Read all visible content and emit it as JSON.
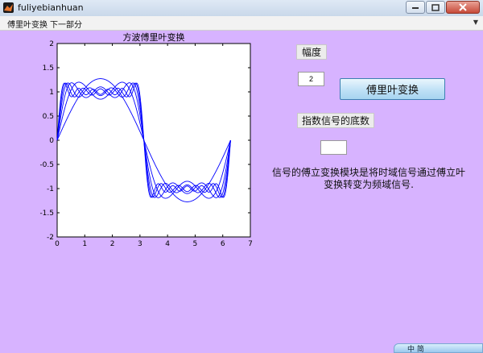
{
  "window": {
    "title": "fuliyebianhuan",
    "background": "#d7b3ff"
  },
  "menubar": {
    "items": [
      "傅里叶变换",
      "下一部分"
    ]
  },
  "chart_data": {
    "type": "line",
    "title": "方波傅里叶变换",
    "xlim": [
      0,
      7
    ],
    "ylim": [
      -2,
      2
    ],
    "xticks": [
      "0",
      "1",
      "2",
      "3",
      "4",
      "5",
      "6",
      "7"
    ],
    "yticks": [
      "2",
      "1.5",
      "1",
      "0.5",
      "0",
      "-0.5",
      "-1",
      "-1.5",
      "-2"
    ],
    "x_range": [
      0,
      6.2832
    ],
    "function": "(4/pi) * sum_{k=1..n} sin((2k-1)x)/(2k-1)",
    "series": [
      {
        "terms": 1
      },
      {
        "terms": 2
      },
      {
        "terms": 3
      },
      {
        "terms": 4
      },
      {
        "terms": 5
      },
      {
        "terms": 6
      }
    ],
    "line_color": "#0000ff",
    "grid": false
  },
  "controls": {
    "amplitude_label": "幅度",
    "amplitude_value": "2",
    "transform_button": "傅里叶变换",
    "exp_label": "指数信号的底数",
    "exp_value": "",
    "description": "信号的傅立变换模块是将时域信号通过傅立叶变换转变为频域信号."
  },
  "tray": {
    "text": "中 简"
  }
}
